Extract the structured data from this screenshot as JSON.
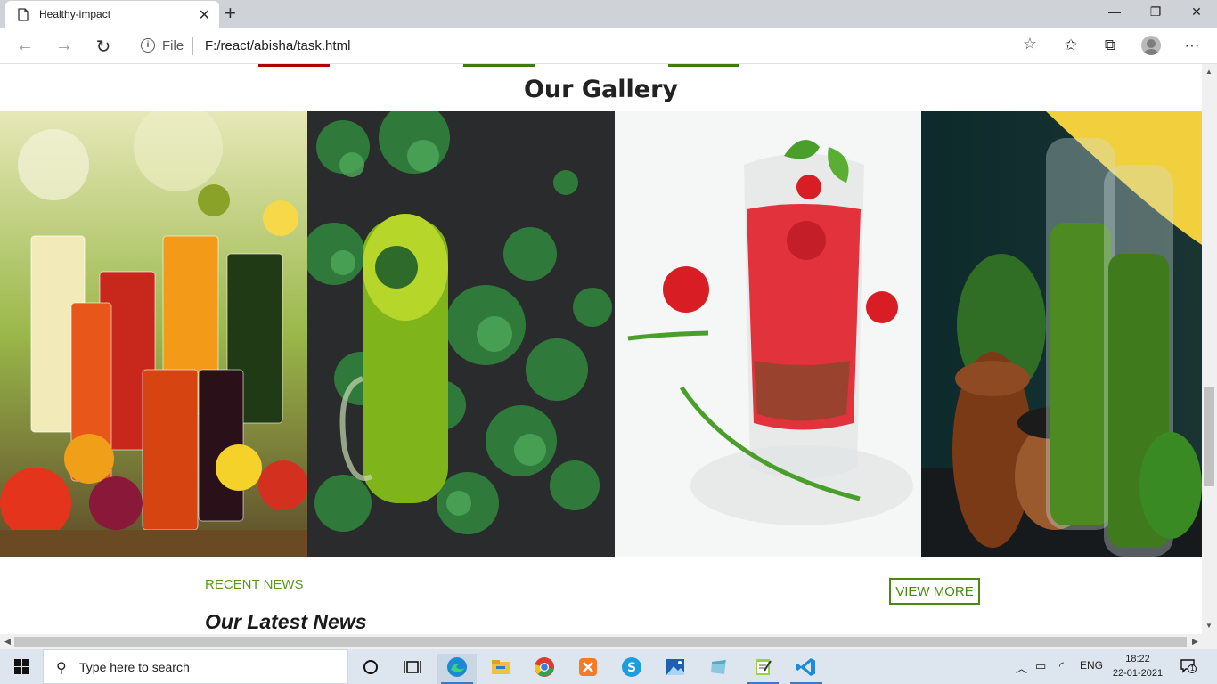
{
  "browser": {
    "tab_title": "Healthy-impact",
    "scheme_label": "File",
    "url": "F:/react/abisha/task.html"
  },
  "page": {
    "gallery_title": "Our Gallery",
    "gallery_images": [
      "assorted fruit juices in glasses",
      "green smoothie with kale",
      "red tomato juice in glass",
      "green smoothies in bottles with spinach and chia"
    ],
    "recent_news_label": "RECENT NEWS",
    "latest_news_title": "Our Latest News",
    "view_more_label": "VIEW MORE",
    "colors": {
      "accent_red": "#b00000",
      "accent_green": "#3b7d10",
      "link_green": "#5a9a1e",
      "button_green": "#4a8a12"
    }
  },
  "taskbar": {
    "search_placeholder": "Type here to search",
    "language": "ENG",
    "time": "18:22",
    "date": "22-01-2021",
    "notification_count": "1",
    "apps": [
      "task-view",
      "edge",
      "file-explorer",
      "chrome",
      "xampp",
      "skype",
      "photos",
      "app-1",
      "notepad",
      "vscode"
    ]
  }
}
